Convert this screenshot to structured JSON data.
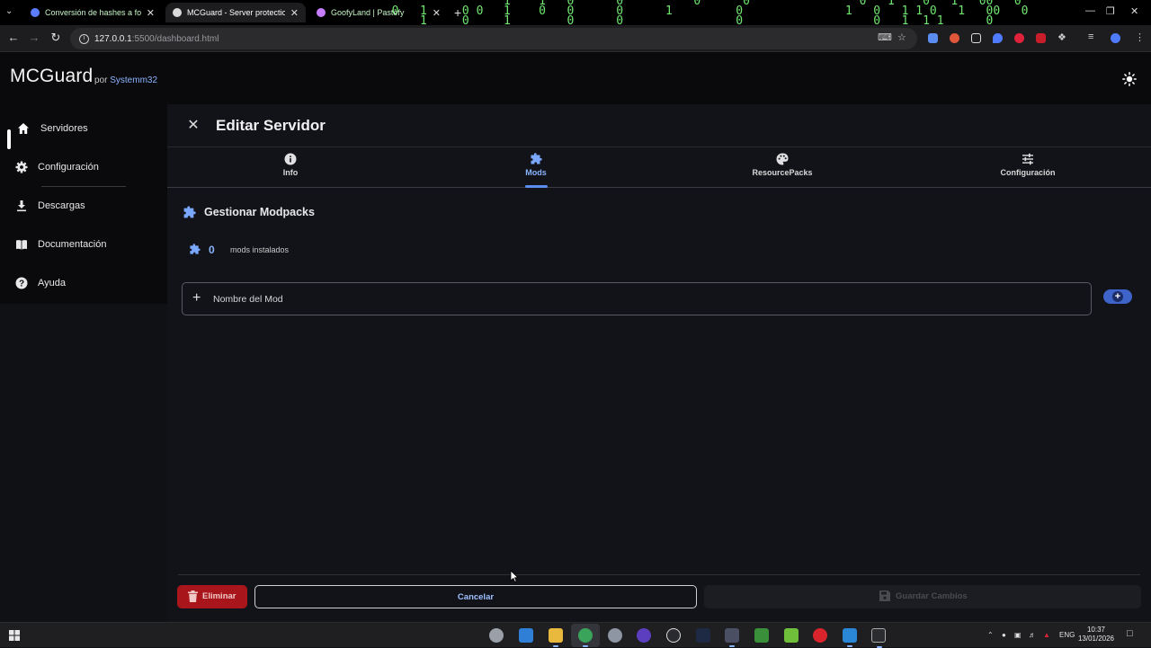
{
  "browser": {
    "tabs": [
      {
        "title": "Conversión de hashes a formato",
        "active": false
      },
      {
        "title": "MCGuard - Server protection an",
        "active": true
      },
      {
        "title": "GoofyLand | Pastefy",
        "active": false
      }
    ],
    "url": {
      "host": "127.0.0.1",
      "rest": ":5500/dashboard.html"
    }
  },
  "app": {
    "brand": "MCGuard",
    "by_prefix": "por",
    "by_name": "Systemm32",
    "theme_icon": "sun-icon"
  },
  "sidebar": {
    "items": [
      {
        "label": "Servidores",
        "icon": "home-icon"
      },
      {
        "label": "Configuración",
        "icon": "gear-icon"
      },
      {
        "label": "Descargas",
        "icon": "download-icon"
      },
      {
        "label": "Documentación",
        "icon": "book-icon"
      },
      {
        "label": "Ayuda",
        "icon": "help-icon"
      }
    ]
  },
  "editor": {
    "title": "Editar Servidor",
    "tabs": [
      {
        "label": "Info",
        "icon": "info-icon"
      },
      {
        "label": "Mods",
        "icon": "puzzle-icon"
      },
      {
        "label": "ResourcePacks",
        "icon": "palette-icon"
      },
      {
        "label": "Configuración",
        "icon": "sliders-icon"
      }
    ],
    "active_tab": "Mods",
    "section_title": "Gestionar Modpacks",
    "mod_count": "0",
    "mod_count_label": "mods instalados",
    "mod_input_placeholder": "Nombre del Mod",
    "buttons": {
      "delete": "Eliminar",
      "cancel": "Cancelar",
      "save": "Guardar Cambios"
    }
  },
  "taskbar": {
    "lang": "ENG",
    "time": "10:37",
    "date": "13/01/2026"
  },
  "colors": {
    "accent": "#8ab4ff",
    "danger": "#a8161b",
    "background": "#121318"
  }
}
